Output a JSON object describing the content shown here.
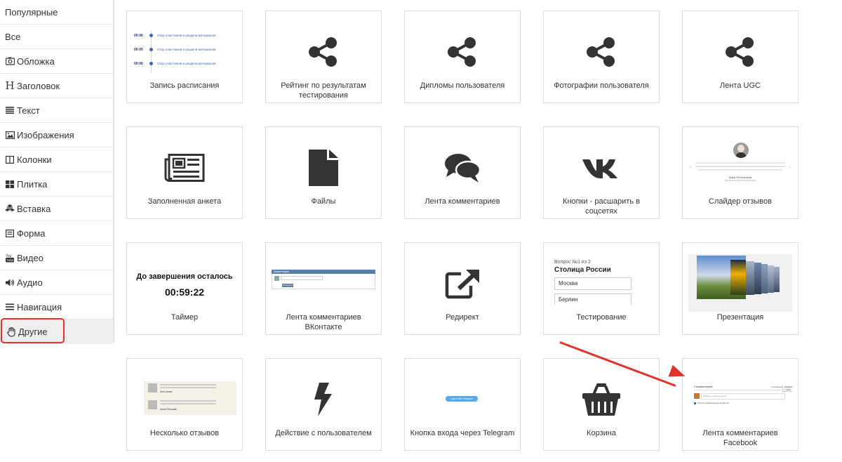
{
  "sidebar": {
    "items": [
      {
        "label": "Популярные",
        "icon": ""
      },
      {
        "label": "Все",
        "icon": ""
      },
      {
        "label": "Обложка",
        "icon": "camera-icon"
      },
      {
        "label": "Заголовок",
        "icon": "heading-icon"
      },
      {
        "label": "Текст",
        "icon": "text-lines-icon"
      },
      {
        "label": "Изображения",
        "icon": "image-icon"
      },
      {
        "label": "Колонки",
        "icon": "columns-icon"
      },
      {
        "label": "Плитка",
        "icon": "tiles-icon"
      },
      {
        "label": "Вставка",
        "icon": "cubes-icon"
      },
      {
        "label": "Форма",
        "icon": "form-icon"
      },
      {
        "label": "Видео",
        "icon": "youtube-icon"
      },
      {
        "label": "Аудио",
        "icon": "volume-icon"
      },
      {
        "label": "Навигация",
        "icon": "menu-icon"
      },
      {
        "label": "Другие",
        "icon": "hand-icon",
        "active": true
      }
    ]
  },
  "cards": [
    {
      "label": "Запись расписания",
      "thumb": "schedule"
    },
    {
      "label": "Рейтинг по результатам тестирования",
      "icon": "share-icon"
    },
    {
      "label": "Дипломы пользователя",
      "icon": "share-icon"
    },
    {
      "label": "Фотографии пользователя",
      "icon": "share-icon"
    },
    {
      "label": "Лента UGC",
      "icon": "share-icon"
    },
    {
      "label": "Заполненная анкета",
      "icon": "newspaper-icon"
    },
    {
      "label": "Файлы",
      "icon": "file-icon"
    },
    {
      "label": "Лента комментариев",
      "icon": "comments-icon"
    },
    {
      "label": "Кнопки - расшарить в соцсетях",
      "icon": "vk-icon"
    },
    {
      "label": "Слайдер отзывов",
      "thumb": "review-slider"
    },
    {
      "label": "Таймер",
      "thumb": "timer"
    },
    {
      "label": "Лента комментариев ВКонтакте",
      "thumb": "vk-comments"
    },
    {
      "label": "Редирект",
      "icon": "external-link-icon"
    },
    {
      "label": "Тестирование",
      "thumb": "quiz"
    },
    {
      "label": "Презентация",
      "thumb": "presentation"
    },
    {
      "label": "Несколько отзывов",
      "thumb": "reviews"
    },
    {
      "label": "Действие с пользователем",
      "icon": "bolt-icon"
    },
    {
      "label": "Кнопка входа через Telegram",
      "thumb": "telegram-button"
    },
    {
      "label": "Корзина",
      "icon": "basket-icon"
    },
    {
      "label": "Лента комментариев Facebook",
      "thumb": "fb-comments"
    }
  ],
  "thumbs": {
    "schedule": {
      "rows": [
        {
          "time": "00:00",
          "title": "Сбор участников и раздача материалов"
        },
        {
          "time": "00:00",
          "title": "Сбор участников и раздача материалов"
        },
        {
          "time": "00:00",
          "title": "Сбор участников и раздача материалов"
        }
      ]
    },
    "timer": {
      "title": "До завершения осталось",
      "time": "00:59:22"
    },
    "quiz": {
      "question_no": "Вопрос №1 из 2",
      "question": "Столица России",
      "options": [
        "Москва",
        "Берлин"
      ]
    },
    "review_slider": {
      "name": "Марк Нетаньгмов"
    },
    "reviews": {
      "names": [
        "Агат Агеев",
        "Агата Петрова"
      ]
    },
    "telegram": {
      "button": "Log in with Telegram"
    },
    "vk": {
      "header": "Комментарии",
      "button": "Отправить"
    },
    "fb": {
      "header": "0 комментариев",
      "sort": "Упорядочить",
      "sort_value": "Сначала новые",
      "input": "Добавьте комментарий...",
      "plugin": "Плагин комментариев Facebook"
    }
  },
  "colors": {
    "accent_red": "#e0332a",
    "icon_dark": "#333333",
    "schedule_blue": "#3a66b5",
    "telegram_blue": "#54a9eb"
  }
}
